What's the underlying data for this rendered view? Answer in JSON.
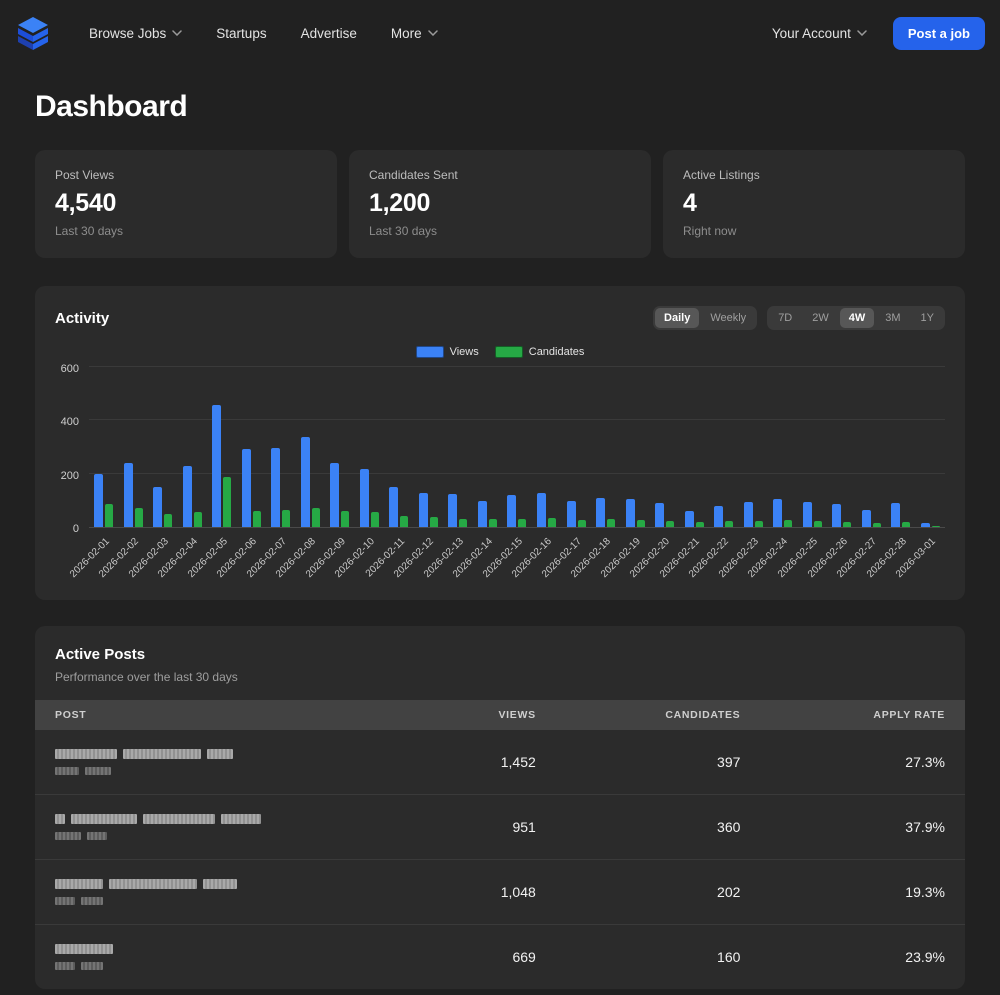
{
  "nav": {
    "links": [
      {
        "label": "Browse Jobs",
        "has_chevron": true
      },
      {
        "label": "Startups",
        "has_chevron": false
      },
      {
        "label": "Advertise",
        "has_chevron": false
      },
      {
        "label": "More",
        "has_chevron": true
      }
    ],
    "account_label": "Your Account",
    "post_job_label": "Post a job"
  },
  "page_title": "Dashboard",
  "stats": [
    {
      "label": "Post Views",
      "value": "4,540",
      "caption": "Last 30 days"
    },
    {
      "label": "Candidates Sent",
      "value": "1,200",
      "caption": "Last 30 days"
    },
    {
      "label": "Active Listings",
      "value": "4",
      "caption": "Right now"
    }
  ],
  "activity": {
    "title": "Activity",
    "mode_options": [
      "Daily",
      "Weekly"
    ],
    "mode_active": "Daily",
    "range_options": [
      "7D",
      "2W",
      "4W",
      "3M",
      "1Y"
    ],
    "range_active": "4W"
  },
  "chart_data": {
    "type": "bar",
    "title": "Activity",
    "x": [
      "2026-02-01",
      "2026-02-02",
      "2026-02-03",
      "2026-02-04",
      "2026-02-05",
      "2026-02-06",
      "2026-02-07",
      "2026-02-08",
      "2026-02-09",
      "2026-02-10",
      "2026-02-11",
      "2026-02-12",
      "2026-02-13",
      "2026-02-14",
      "2026-02-15",
      "2026-02-16",
      "2026-02-17",
      "2026-02-18",
      "2026-02-19",
      "2026-02-20",
      "2026-02-21",
      "2026-02-22",
      "2026-02-23",
      "2026-02-24",
      "2026-02-25",
      "2026-02-26",
      "2026-02-27",
      "2026-02-28",
      "2026-03-01"
    ],
    "series": [
      {
        "name": "Views",
        "color": "#3b82f6",
        "values": [
          200,
          240,
          150,
          230,
          460,
          295,
          300,
          340,
          240,
          220,
          150,
          130,
          125,
          100,
          120,
          130,
          100,
          110,
          105,
          90,
          60,
          80,
          95,
          105,
          95,
          85,
          65,
          90,
          15
        ]
      },
      {
        "name": "Candidates",
        "color": "#26a945",
        "values": [
          85,
          70,
          50,
          55,
          190,
          60,
          65,
          70,
          60,
          55,
          40,
          38,
          32,
          30,
          32,
          35,
          28,
          30,
          26,
          24,
          18,
          22,
          24,
          26,
          24,
          20,
          15,
          20,
          5
        ]
      }
    ],
    "ylim": [
      0,
      600
    ],
    "yticks": [
      0,
      200,
      400,
      600
    ],
    "grid": true,
    "legend_position": "top-center"
  },
  "posts": {
    "title": "Active Posts",
    "subtitle": "Performance over the last 30 days",
    "columns": [
      "Post",
      "Views",
      "Candidates",
      "Apply Rate"
    ],
    "rows": [
      {
        "title_redacted": true,
        "title_blocks": [
          62,
          78,
          26
        ],
        "subtitle_blocks": [
          24,
          26
        ],
        "views": "1,452",
        "candidates": "397",
        "apply_rate": "27.3%"
      },
      {
        "title_redacted": true,
        "title_blocks": [
          10,
          66,
          72,
          40
        ],
        "subtitle_blocks": [
          26,
          20
        ],
        "views": "951",
        "candidates": "360",
        "apply_rate": "37.9%"
      },
      {
        "title_redacted": true,
        "title_blocks": [
          48,
          88,
          34
        ],
        "subtitle_blocks": [
          20,
          22
        ],
        "views": "1,048",
        "candidates": "202",
        "apply_rate": "19.3%"
      },
      {
        "title_redacted": true,
        "title_blocks": [
          58
        ],
        "subtitle_blocks": [
          20,
          22
        ],
        "views": "669",
        "candidates": "160",
        "apply_rate": "23.9%"
      }
    ]
  },
  "colors": {
    "accent_blue": "#2563eb",
    "views_blue": "#3b82f6",
    "candidates_green": "#26a945",
    "card_bg": "#2b2b2b",
    "page_bg": "#212121"
  }
}
